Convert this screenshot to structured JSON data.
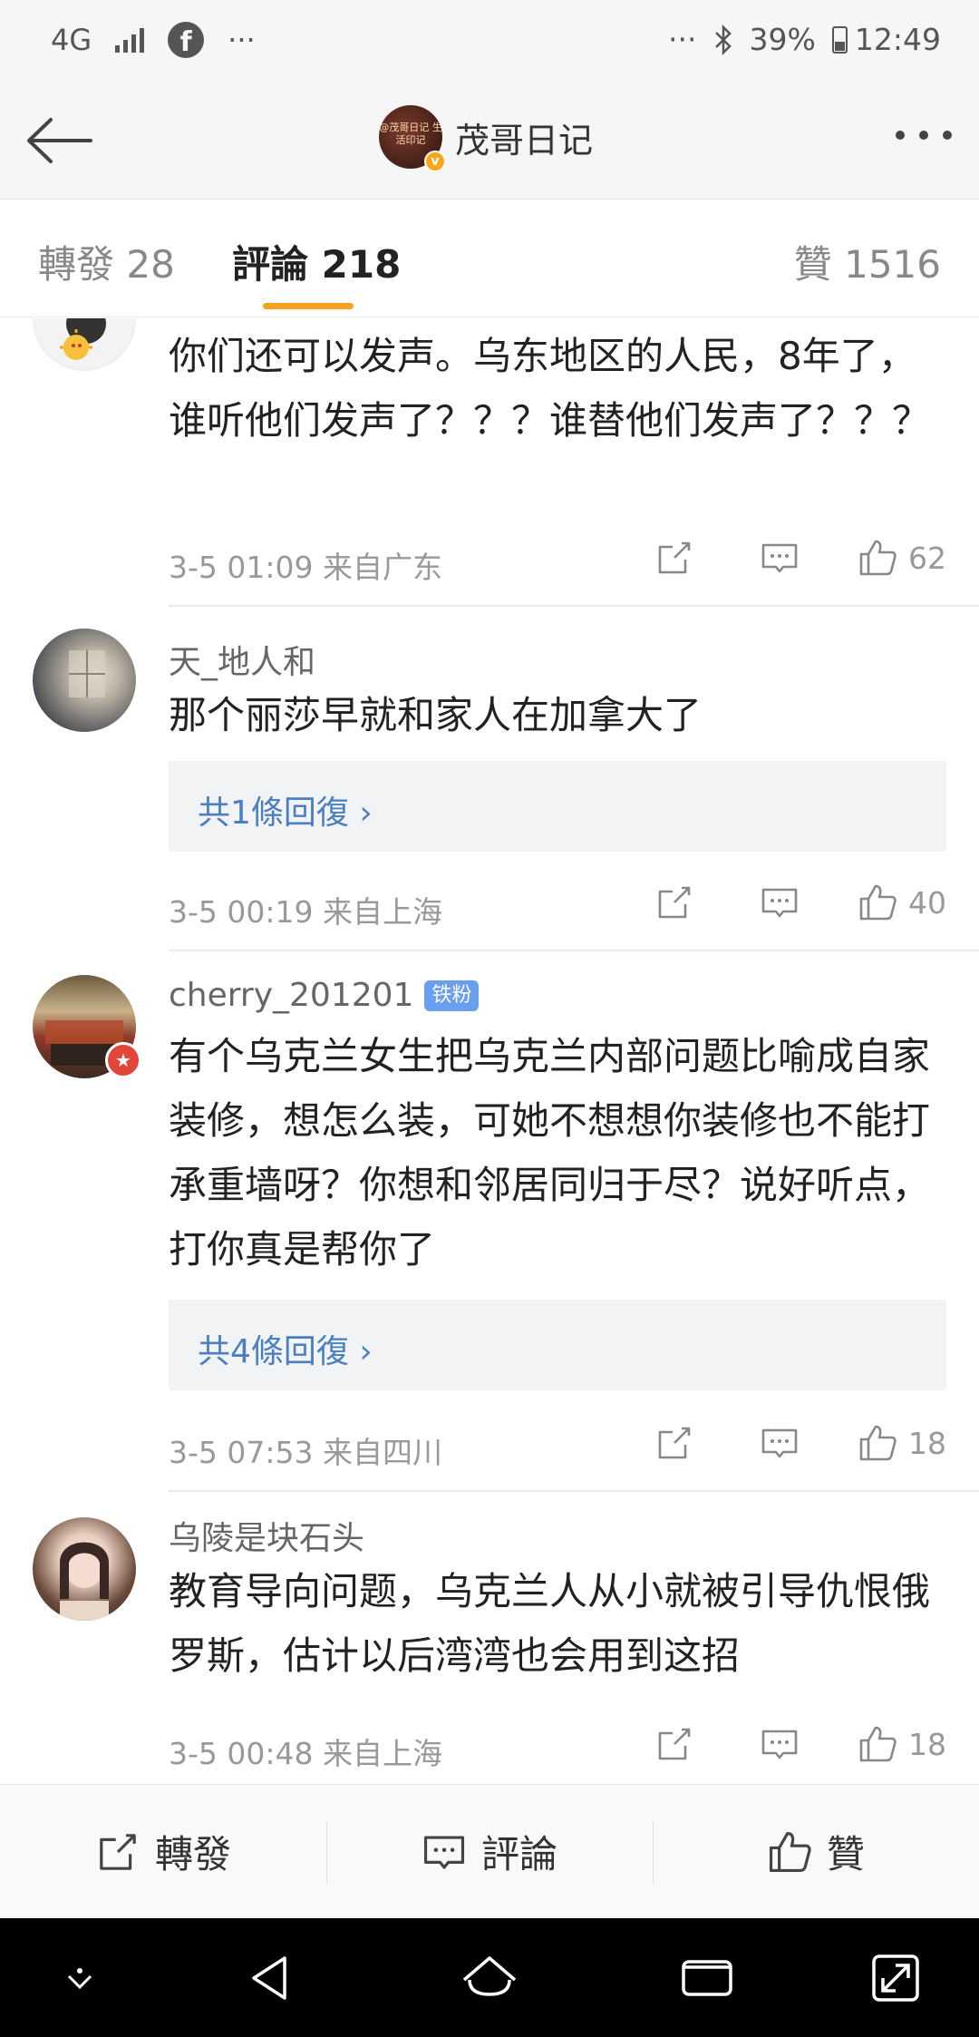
{
  "status_bar": {
    "network": "4G",
    "more_left": "···",
    "more_right": "···",
    "battery": "39%",
    "time": "12:49"
  },
  "header": {
    "avatar_text": "@茂哥日记 生活印记",
    "title": "茂哥日记"
  },
  "tabs": [
    {
      "label": "轉發 28"
    },
    {
      "label": "評論 218"
    },
    {
      "label": "贊 1516"
    }
  ],
  "comments": [
    {
      "username": "",
      "text": "你们还可以发声。乌东地区的人民，8年了，谁听他们发声了？？？谁替他们发声了？？？",
      "time": "3-5 01:09  来自广东",
      "likes": "62"
    },
    {
      "username": "天_地人和",
      "text": "那个丽莎早就和家人在加拿大了",
      "reply": "共1條回復 ›",
      "time": "3-5 00:19  来自上海",
      "likes": "40"
    },
    {
      "username": "cherry_201201",
      "badge": "铁粉",
      "text": "有个乌克兰女生把乌克兰内部问题比喻成自家装修，想怎么装，可她不想想你装修也不能打承重墙呀？你想和邻居同归于尽？说好听点，打你真是帮你了",
      "reply": "共4條回復 ›",
      "time": "3-5 07:53  来自四川",
      "likes": "18"
    },
    {
      "username": "乌陵是块石头",
      "text": "教育导向问题，乌克兰人从小就被引导仇恨俄罗斯，估计以后湾湾也会用到这招",
      "time": "3-5 00:48  来自上海",
      "likes": "18"
    }
  ],
  "bottom_bar": {
    "repost": "轉發",
    "comment": "評論",
    "like": "贊"
  },
  "colors": {
    "accent": "#f7a21b",
    "link": "#4a7fc1",
    "fan_badge": "#6a9ff0"
  }
}
